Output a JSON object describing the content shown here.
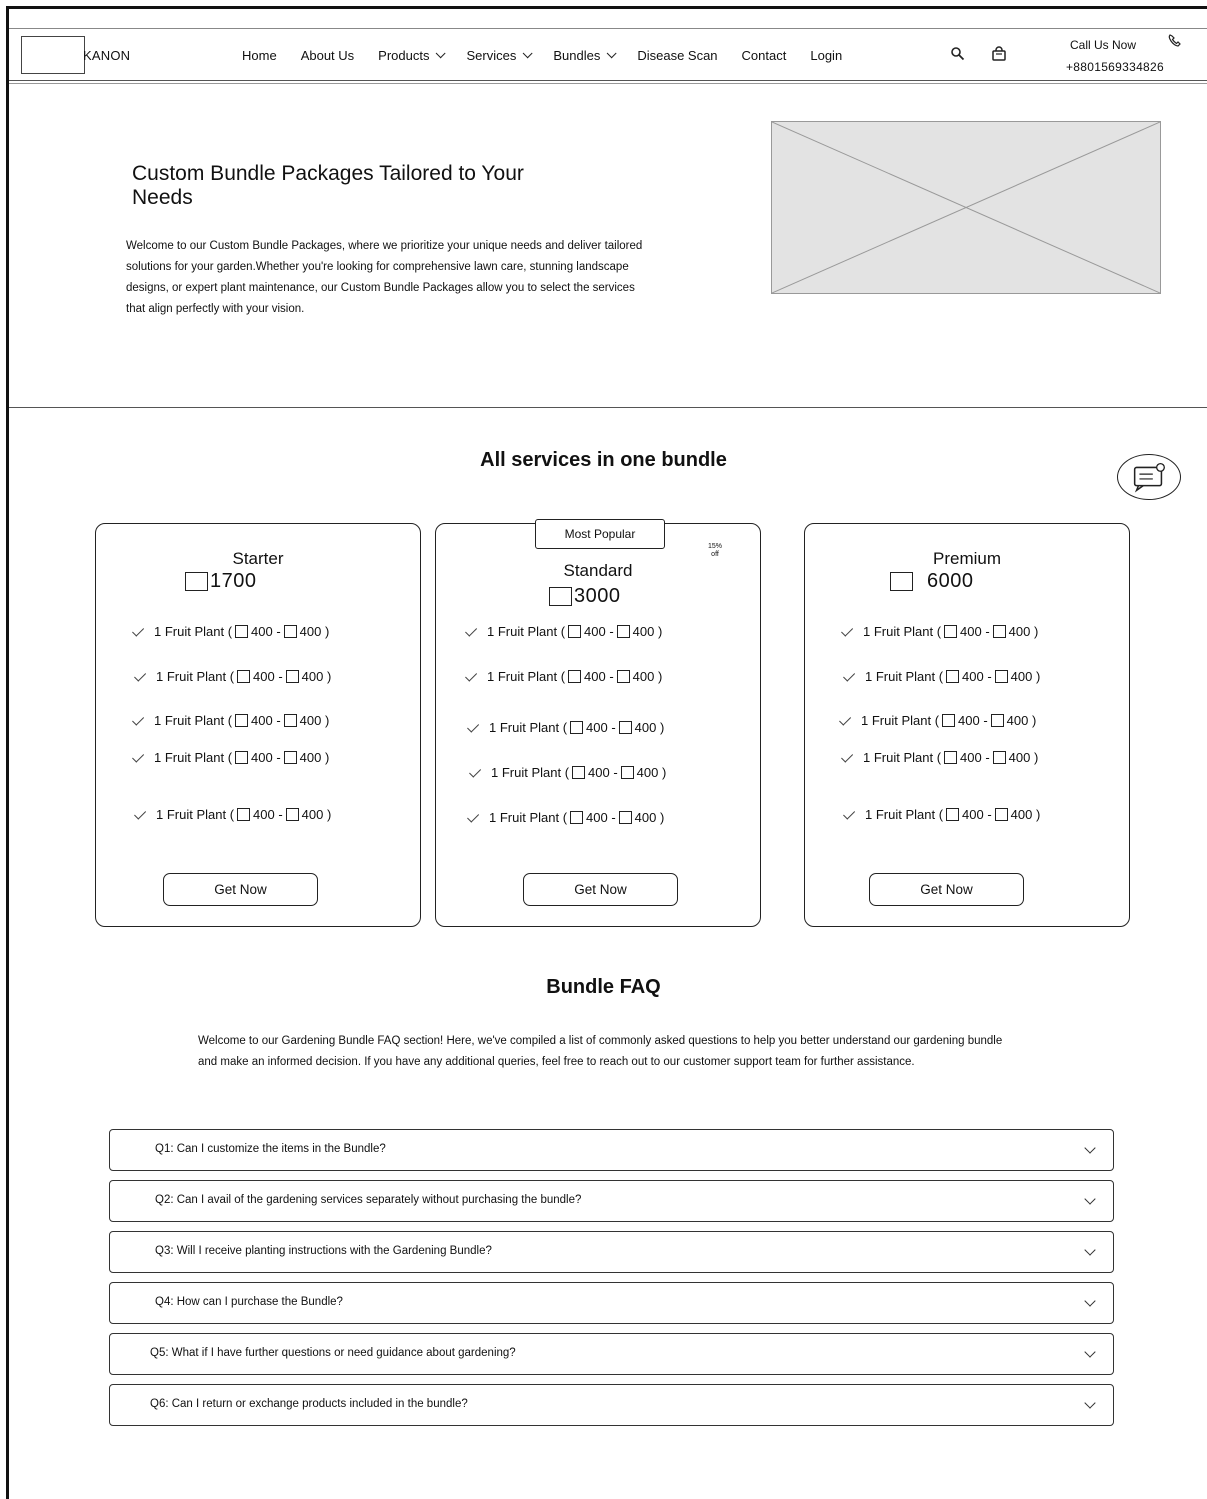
{
  "header": {
    "brand": "KANON",
    "nav": {
      "home": "Home",
      "about": "About Us",
      "products": "Products",
      "services": "Services",
      "bundles": "Bundles",
      "disease_scan": "Disease Scan",
      "contact": "Contact",
      "login": "Login"
    },
    "call_label": "Call Us Now",
    "call_number": "+8801569334826",
    "icons": [
      "search-icon",
      "shopping-bag-icon",
      "phone-icon"
    ]
  },
  "hero": {
    "title": "Custom Bundle Packages Tailored to Your Needs",
    "text": "Welcome to our Custom Bundle Packages, where we prioritize your unique needs and deliver tailored solutions for your garden.Whether you're looking for comprehensive lawn care, stunning landscape designs, or expert plant maintenance, our Custom Bundle Packages allow you to select the services that align perfectly with your vision."
  },
  "bundles": {
    "title": "All services in one bundle",
    "cards": [
      {
        "name": "Starter",
        "price": "1700",
        "features": [
          {
            "label": "1 Fruit Plant (",
            "from": "400 -",
            "to": "400 )"
          },
          {
            "label": "1 Fruit Plant (",
            "from": "400 -",
            "to": "400 )"
          },
          {
            "label": "1 Fruit Plant (",
            "from": "400 -",
            "to": "400 )"
          },
          {
            "label": "1 Fruit Plant (",
            "from": "400 -",
            "to": "400 )"
          },
          {
            "label": "1 Fruit Plant (",
            "from": "400 -",
            "to": "400 )"
          }
        ],
        "button": "Get Now"
      },
      {
        "name": "Standard",
        "price": "3000",
        "badge": "Most Popular",
        "discount_pct": "15%",
        "discount_word": "off",
        "features": [
          {
            "label": "1 Fruit Plant (",
            "from": "400 -",
            "to": "400 )"
          },
          {
            "label": "1 Fruit Plant (",
            "from": "400 -",
            "to": "400 )"
          },
          {
            "label": "1 Fruit Plant (",
            "from": "400 -",
            "to": "400 )"
          },
          {
            "label": "1 Fruit Plant (",
            "from": "400 -",
            "to": "400 )"
          },
          {
            "label": "1 Fruit Plant (",
            "from": "400 -",
            "to": "400 )"
          }
        ],
        "button": "Get Now"
      },
      {
        "name": "Premium",
        "price": "6000",
        "features": [
          {
            "label": "1 Fruit Plant (",
            "from": "400 -",
            "to": "400 )"
          },
          {
            "label": "1 Fruit Plant (",
            "from": "400 -",
            "to": "400 )"
          },
          {
            "label": "1 Fruit Plant (",
            "from": "400 -",
            "to": "400 )"
          },
          {
            "label": "1 Fruit Plant (",
            "from": "400 -",
            "to": "400 )"
          },
          {
            "label": "1 Fruit Plant (",
            "from": "400 -",
            "to": "400 )"
          }
        ],
        "button": "Get Now"
      }
    ]
  },
  "faq": {
    "title": "Bundle FAQ",
    "intro": "Welcome to our Gardening Bundle FAQ section! Here, we've compiled a list of commonly asked questions to help you better understand our gardening bundle and make an informed decision. If you have any additional queries, feel free to reach out to our customer support team for further assistance.",
    "items": [
      "Q1: Can I customize the items in the  Bundle?",
      "Q2: Can I avail of the gardening services separately without purchasing the bundle?",
      "Q3: Will I receive planting instructions with the Gardening Bundle?",
      "Q4: How can I purchase the Bundle?",
      "Q5: What if I have further questions or need guidance about gardening?",
      "Q6: Can I return or exchange products included in the bundle?"
    ]
  }
}
